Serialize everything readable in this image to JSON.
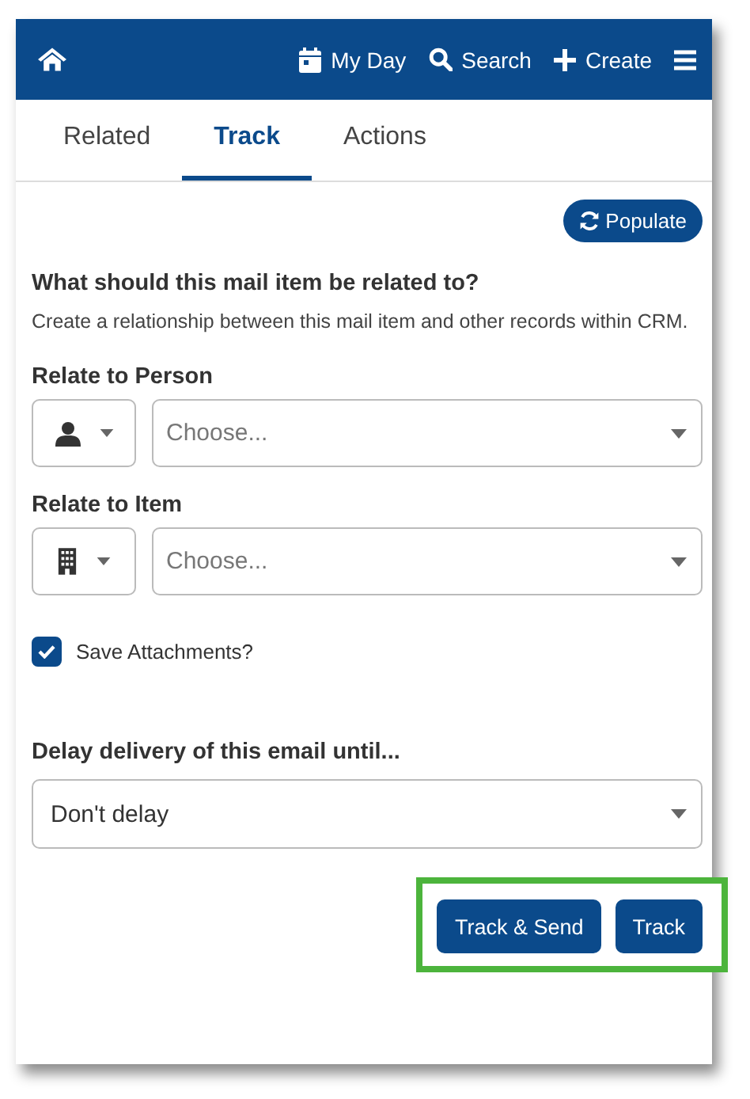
{
  "header": {
    "nav": [
      {
        "kind": "calendar",
        "label": "My Day"
      },
      {
        "kind": "search",
        "label": "Search"
      },
      {
        "kind": "plus",
        "label": "Create"
      }
    ]
  },
  "tabs": [
    {
      "label": "Related",
      "selected": false
    },
    {
      "label": "Track",
      "selected": true
    },
    {
      "label": "Actions",
      "selected": false
    }
  ],
  "populate_button": "Populate",
  "section": {
    "title": "What should this mail item be related to?",
    "description": "Create a relationship between this mail item and other records within CRM."
  },
  "relations": [
    {
      "label": "Relate to Person",
      "kind": "person",
      "placeholder": "Choose..."
    },
    {
      "label": "Relate to Item",
      "kind": "building",
      "placeholder": "Choose..."
    }
  ],
  "save_attachments": {
    "label": "Save Attachments?",
    "checked": true
  },
  "delay": {
    "label": "Delay delivery of this email until...",
    "value": "Don't delay"
  },
  "actions": [
    "Track & Send",
    "Track"
  ]
}
